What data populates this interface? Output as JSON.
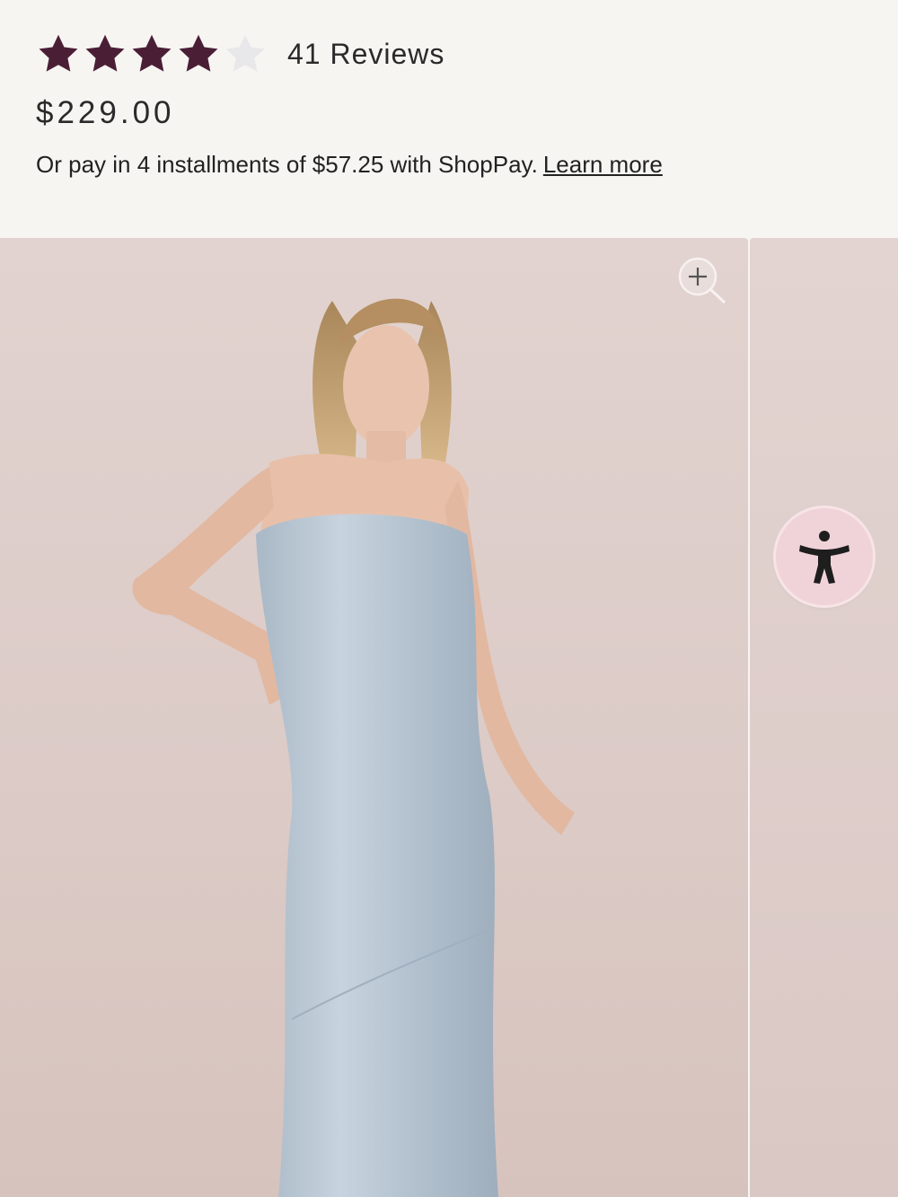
{
  "product": {
    "rating": 4,
    "rating_max": 5,
    "reviews_label": "41 Reviews",
    "price": "$229.00",
    "installments_text": "Or pay in 4 installments of $57.25 with ShopPay.",
    "learn_more_label": "Learn more"
  },
  "gallery": {
    "zoom_icon": "zoom-in-icon",
    "accessibility_icon": "accessibility-icon"
  },
  "colors": {
    "star_filled": "#4a1f35",
    "star_empty": "#e8e8ea",
    "photo_background": "#dccbc7",
    "accessibility_button": "#f0d3d8"
  }
}
